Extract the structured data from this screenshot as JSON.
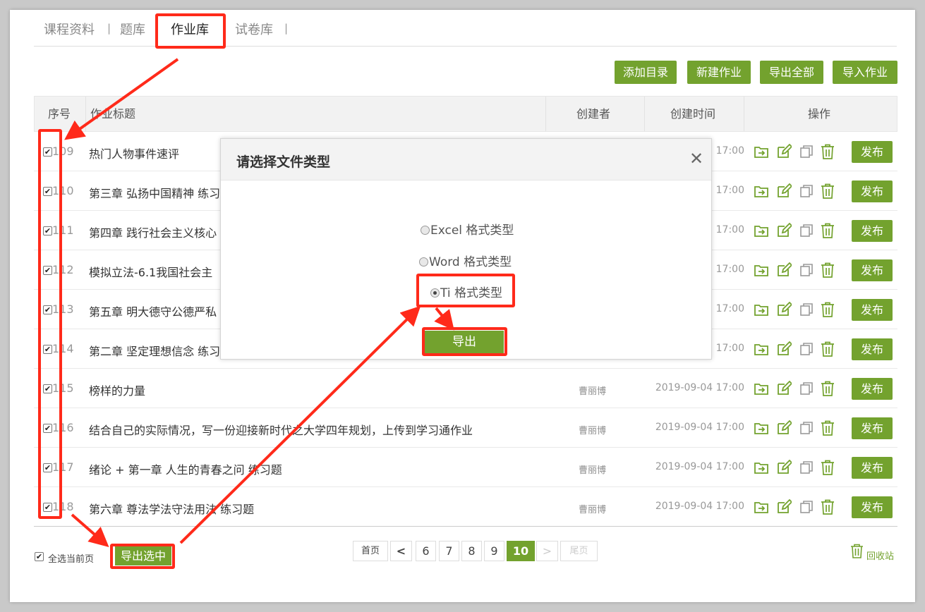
{
  "tabs": [
    {
      "label": "课程资料",
      "active": false
    },
    {
      "label": "题库",
      "active": false
    },
    {
      "label": "作业库",
      "active": true
    },
    {
      "label": "试卷库",
      "active": false
    }
  ],
  "tab_separator": "|",
  "toolbar": {
    "add_catalog": "添加目录",
    "new_homework": "新建作业",
    "export_all": "导出全部",
    "import_homework": "导入作业"
  },
  "table": {
    "headers": {
      "seq": "序号",
      "title": "作业标题",
      "creator": "创建者",
      "created_time": "创建时间",
      "actions": "操作"
    },
    "publish_label": "发布",
    "rows": [
      {
        "num": "109",
        "title": "热门人物事件速评",
        "creator": "",
        "time": "17:00"
      },
      {
        "num": "110",
        "title": "第三章 弘扬中国精神 练习",
        "creator": "",
        "time": "17:00"
      },
      {
        "num": "111",
        "title": "第四章 践行社会主义核心",
        "creator": "",
        "time": "17:00"
      },
      {
        "num": "112",
        "title": "模拟立法-6.1我国社会主",
        "creator": "",
        "time": "17:00"
      },
      {
        "num": "113",
        "title": "第五章 明大德守公德严私",
        "creator": "",
        "time": "17:00"
      },
      {
        "num": "114",
        "title": "第二章 坚定理想信念 练习",
        "creator": "",
        "time": "17:00"
      },
      {
        "num": "115",
        "title": "榜样的力量",
        "creator": "曹丽博",
        "time": "2019-09-04 17:00"
      },
      {
        "num": "116",
        "title": "结合自己的实际情况，写一份迎接新时代之大学四年规划，上传到学习通作业",
        "creator": "曹丽博",
        "time": "2019-09-04 17:00"
      },
      {
        "num": "117",
        "title": "绪论 + 第一章 人生的青春之问 练习题",
        "creator": "曹丽博",
        "time": "2019-09-04 17:00"
      },
      {
        "num": "118",
        "title": "第六章 尊法学法守法用法 练习题",
        "creator": "曹丽博",
        "time": "2019-09-04 17:00"
      }
    ]
  },
  "footer": {
    "select_all_label": "全选当前页",
    "export_selected": "导出选中",
    "recycle_bin": "回收站"
  },
  "pagination": {
    "first": "首页",
    "prev": "<",
    "pages": [
      "6",
      "7",
      "8",
      "9",
      "10"
    ],
    "current": "10",
    "next": ">",
    "last": "尾页"
  },
  "modal": {
    "title": "请选择文件类型",
    "close": "✕",
    "options": [
      {
        "label": "Excel 格式类型",
        "selected": false
      },
      {
        "label": "Word 格式类型",
        "selected": false
      },
      {
        "label": "Ti 格式类型",
        "selected": true
      }
    ],
    "export_button": "导出"
  },
  "colors": {
    "accent_green": "#73a22e",
    "annotation_red": "#ff2a1a"
  },
  "icons": [
    "move-to-icon",
    "edit-icon",
    "copy-icon",
    "delete-icon",
    "checkbox-icon",
    "radio-icon",
    "recycle-bin-icon",
    "close-icon"
  ]
}
